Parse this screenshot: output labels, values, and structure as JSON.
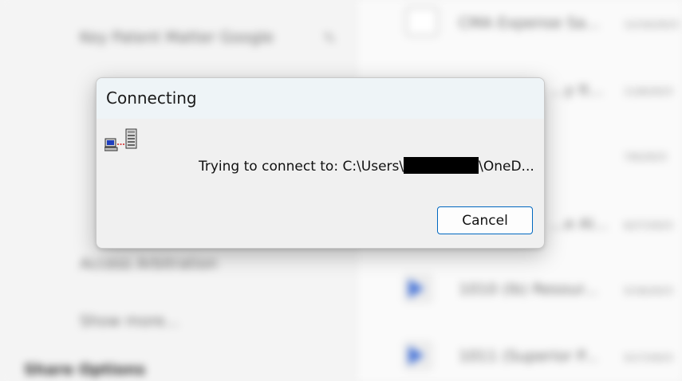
{
  "background": {
    "left_items": [
      "Key Patent Matter Google",
      "Access Arbitration",
      "Show more...",
      "Share Options"
    ],
    "right_files": [
      {
        "name": "CMA Expense Sa...",
        "date": "12/16/2023"
      },
      {
        "name": "...y It...",
        "date": "11/8/2023"
      },
      {
        "name": "",
        "date": "7/6/2023"
      },
      {
        "name": "...e Al...",
        "date": "6/27/2023"
      },
      {
        "name": "1010 (lb) Resour...",
        "date": "5/18/2023"
      },
      {
        "name": "1011 (Superior P...",
        "date": "5/17/2023"
      }
    ]
  },
  "dialog": {
    "title": "Connecting",
    "message_prefix": "Trying to connect to: C:\\Users\\",
    "message_suffix": "\\OneD...",
    "cancel_label": "Cancel",
    "accent_color": "#0067c0"
  }
}
